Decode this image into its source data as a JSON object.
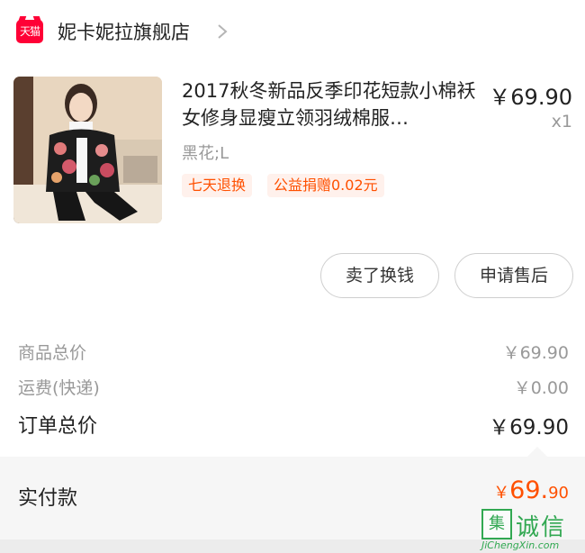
{
  "store": {
    "badge": "天猫",
    "name": "妮卡妮拉旗舰店",
    "chevron_icon": "chevron-right-icon"
  },
  "product": {
    "image": "product-photo-floral-jacket",
    "title": "2017秋冬新品反季印花短款小棉袄女修身显瘦立领羽绒棉服…",
    "price": "￥69.90",
    "quantity": "x1",
    "variant": "黑花;L",
    "tags": [
      "七天退换",
      "公益捐赠0.02元"
    ]
  },
  "actions": {
    "exchange": "卖了换钱",
    "after_sale": "申请售后"
  },
  "summary": {
    "goods_total_label": "商品总价",
    "goods_total_value": "￥69.90",
    "shipping_label": "运费(快递)",
    "shipping_value": "￥0.00",
    "order_total_label": "订单总价",
    "order_total_value": "￥69.90"
  },
  "payment": {
    "label": "实付款",
    "currency": "￥",
    "integer": "69.",
    "decimal": "90"
  },
  "watermark": {
    "mark": "集",
    "text": "诚信",
    "url": "JiChengXin.com"
  },
  "colors": {
    "accent": "#ff5000",
    "tmall_red": "#ff0036",
    "watermark_green": "#32a852"
  }
}
